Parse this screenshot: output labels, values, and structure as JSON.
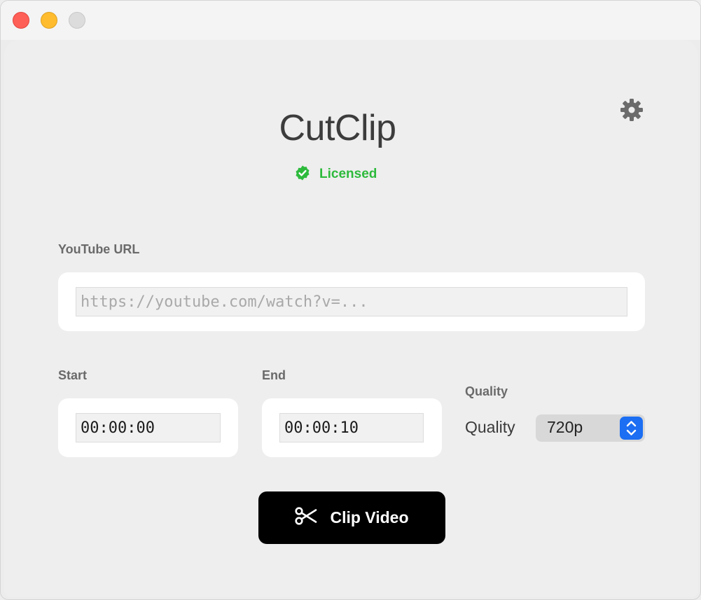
{
  "window": {
    "controls": [
      "close",
      "minimize",
      "zoom"
    ]
  },
  "header": {
    "title": "CutClip",
    "settings_icon": "gear-icon",
    "license_status": "Licensed",
    "license_icon": "verified-badge-icon",
    "license_color": "#2dba3c"
  },
  "url_section": {
    "label": "YouTube URL",
    "value": "",
    "placeholder": "https://youtube.com/watch?v=..."
  },
  "start": {
    "label": "Start",
    "value": "00:00:00"
  },
  "end": {
    "label": "End",
    "value": "00:00:10"
  },
  "quality": {
    "section_label": "Quality",
    "field_label": "Quality",
    "selected": "720p",
    "accent": "#1c6ef2"
  },
  "action": {
    "label": "Clip Video",
    "icon": "scissors-icon"
  }
}
